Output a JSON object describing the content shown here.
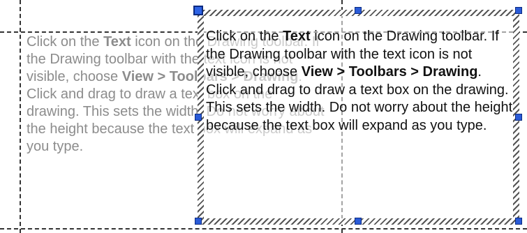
{
  "ghost_text": {
    "p1_a": "Click on the ",
    "p1_b": "Text",
    "p1_c": " icon on the Drawing toolbar. If the Drawing toolbar with the text icon is not visible, choose ",
    "p1_d": "View > Toolbars > Drawing",
    "p1_e": ".",
    "p2": "Click and drag to draw a text box on the drawing. This sets the width. Do not worry about the height because the text box will expand as you type."
  },
  "selected_text": {
    "p1_a": "Click on the ",
    "p1_b": "Text",
    "p1_c": " icon on the Drawing toolbar. If the Drawing toolbar with the text icon is not visible, choose ",
    "p1_d": "View > Toolbars > Drawing",
    "p1_e": ".",
    "p2": "Click and drag to draw a text box on the drawing. This sets the width. Do not worry about the height because the text box will expand as you type."
  },
  "colors": {
    "handle": "#2a5bd7",
    "ghost_text": "#8c8c8c",
    "text": "#111111"
  }
}
